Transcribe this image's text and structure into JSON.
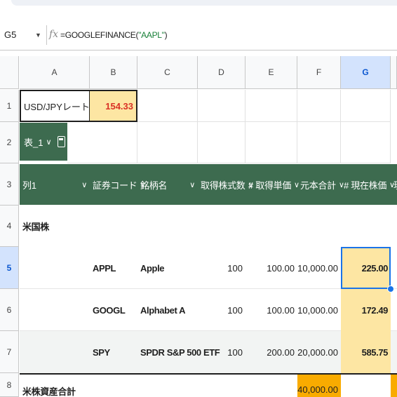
{
  "formula_bar": {
    "cell_ref": "G5",
    "formula_prefix": "=GOOGLEFINANCE(",
    "formula_arg": "\"AAPL\"",
    "formula_suffix": ")"
  },
  "columns": [
    "A",
    "B",
    "C",
    "D",
    "E",
    "F",
    "G"
  ],
  "rows": [
    "1",
    "2",
    "3",
    "4",
    "5",
    "6",
    "7",
    "8"
  ],
  "rate": {
    "label": "USD/JPYレート",
    "value": "154.33"
  },
  "table_chip": {
    "name": "表_1",
    "arrow": "∨"
  },
  "table_headers": [
    {
      "label": "列1",
      "arrow": "∨"
    },
    {
      "label": "証券コード",
      "arrow": "∨"
    },
    {
      "label": "銘柄名",
      "arrow": "∨"
    },
    {
      "label": "取得株式数",
      "arrow": "∨"
    },
    {
      "label": "# 取得単価",
      "arrow": "∨"
    },
    {
      "label": "元本合計",
      "arrow": "∨"
    },
    {
      "label": "# 現在株価",
      "arrow": "∨"
    },
    {
      "label": "現",
      "arrow": ""
    }
  ],
  "group_label": "米国株",
  "holdings": [
    {
      "code": "APPL",
      "name": "Apple",
      "shares": "100",
      "unit_cost": "100.00",
      "principal": "10,000.00",
      "price": "225.00"
    },
    {
      "code": "GOOGL",
      "name": "Alphabet A",
      "shares": "100",
      "unit_cost": "100.00",
      "principal": "10,000.00",
      "price": "172.49"
    },
    {
      "code": "SPY",
      "name": "SPDR S&P 500 ETF",
      "shares": "100",
      "unit_cost": "200.00",
      "principal": "20,000.00",
      "price": "585.75"
    }
  ],
  "total": {
    "label": "米株資産合計",
    "principal": "40,000.00"
  },
  "colors": {
    "table_header": "#3d6b4f",
    "highlight": "#fde6a3",
    "selection": "#1a73e8",
    "rate_text": "#d93025"
  }
}
